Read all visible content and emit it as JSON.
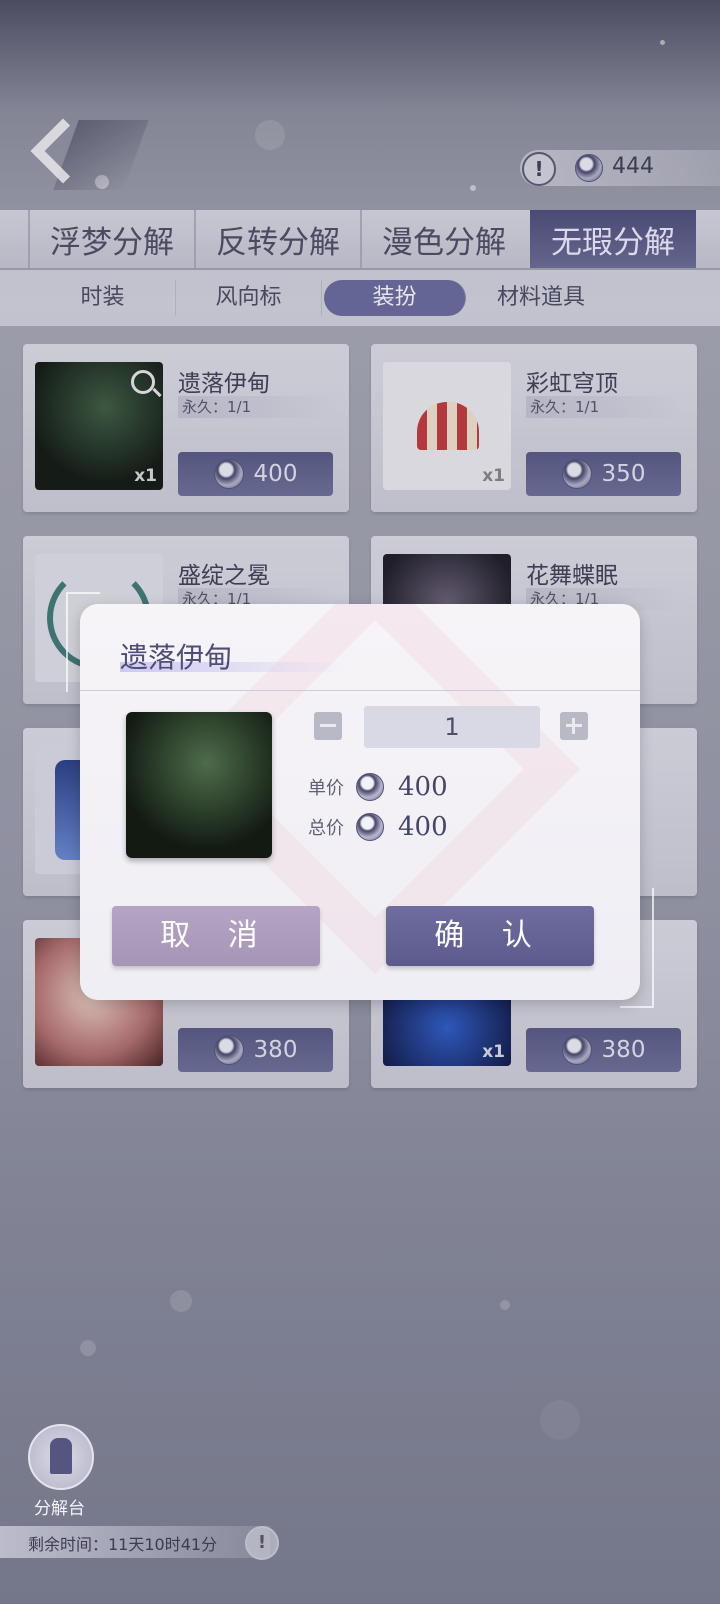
{
  "currency": {
    "icon": "crystal-gem-icon",
    "amount": "444"
  },
  "main_tabs": [
    {
      "label": "浮梦分解"
    },
    {
      "label": "反转分解"
    },
    {
      "label": "漫色分解"
    },
    {
      "label": "无瑕分解",
      "active": true
    }
  ],
  "sub_tabs": [
    {
      "label": "时装"
    },
    {
      "label": "风向标"
    },
    {
      "label": "装扮",
      "active": true
    },
    {
      "label": "材料道具"
    }
  ],
  "cards": [
    {
      "name": "遗落伊甸",
      "duration": "永久：1/1",
      "price": "400",
      "qty": "x1"
    },
    {
      "name": "彩虹穹顶",
      "duration": "永久：1/1",
      "price": "350",
      "qty": "x1"
    },
    {
      "name": "盛绽之冕",
      "duration": "永久：1/1",
      "price": "",
      "qty": ""
    },
    {
      "name": "花舞蝶眠",
      "duration": "永久：1/1",
      "price": "",
      "qty": ""
    },
    {
      "name": "",
      "duration": "",
      "price": "380",
      "qty": ""
    },
    {
      "name": "",
      "duration": "",
      "price": "380",
      "qty": "x1"
    }
  ],
  "dialog": {
    "title": "遗落伊甸",
    "quantity": "1",
    "unit_price_label": "单价",
    "unit_price": "400",
    "total_price_label": "总价",
    "total_price": "400",
    "cancel_label": "取 消",
    "confirm_label": "确 认"
  },
  "bottom": {
    "decompose_label": "分解台",
    "timer_text": "剩余时间：11天10时41分"
  },
  "colors": {
    "accent": "#5c5b8c",
    "cancel": "#a795b8",
    "price_bg": "#585a86"
  }
}
